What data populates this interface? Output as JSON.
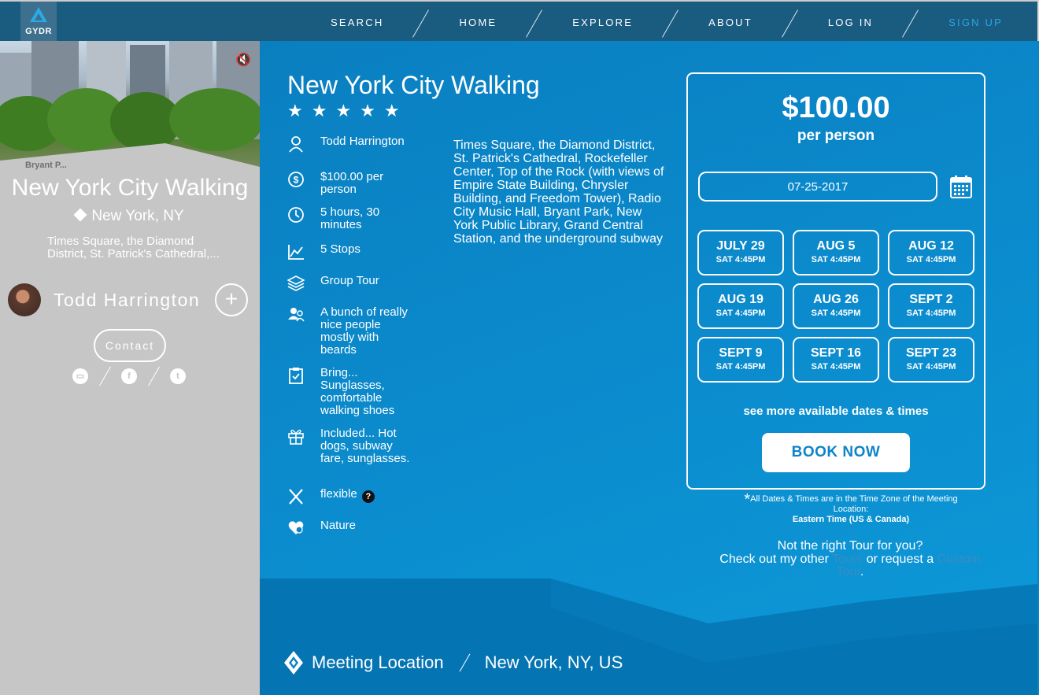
{
  "colors": {
    "header": "#1a5b80",
    "accent": "#28a8e4",
    "main_bg": "#0a84c4",
    "sidebar_bg": "#c6c6c6"
  },
  "header": {
    "logo_text": "GYDR",
    "nav": [
      {
        "label": "SEARCH"
      },
      {
        "label": "HOME"
      },
      {
        "label": "EXPLORE"
      },
      {
        "label": "ABOUT"
      },
      {
        "label": "LOG IN"
      },
      {
        "label": "SIGN UP"
      }
    ]
  },
  "sidebar": {
    "hero_caption": "Bryant P...",
    "title": "New York City Walking",
    "location": "New York, NY",
    "description": "Times Square, the Diamond District, St. Patrick's Cathedral,...",
    "guide_name": "Todd Harrington",
    "follow_symbol": "+",
    "contact_label": "Contact",
    "social_icons": [
      "monitor-icon",
      "facebook-icon",
      "twitter-icon"
    ]
  },
  "tour": {
    "title": "New York City Walking",
    "rating_stars": 5,
    "features": [
      {
        "icon": "user-icon",
        "label": "Todd Harrington"
      },
      {
        "icon": "dollar-icon",
        "label": "$100.00 per person"
      },
      {
        "icon": "clock-icon",
        "label": "5 hours, 30 minutes"
      },
      {
        "icon": "chart-icon",
        "label": "5 Stops"
      },
      {
        "icon": "layers-icon",
        "label": "Group Tour"
      },
      {
        "icon": "group-icon",
        "label": "A bunch of really nice people mostly with beards"
      },
      {
        "icon": "clipboard-icon",
        "label": "Bring... Sunglasses, comfortable walking shoes"
      },
      {
        "icon": "gift-icon",
        "label": "Included... Hot dogs, subway fare, sunglasses."
      },
      {
        "icon": "x-icon",
        "label": "flexible"
      },
      {
        "icon": "heart-icon",
        "label": "Nature"
      }
    ],
    "help_symbol": "?",
    "description": "Times Square, the Diamond District, St. Patrick's Cathedral, Rockefeller Center, Top of the Rock (with views of Empire State Building, Chrysler Building, and Freedom Tower), Radio City Music Hall, Bryant Park, New York Public Library, Grand Central Station, and the underground subway"
  },
  "booking": {
    "price": "$100.00",
    "per_person": "per person",
    "date_value": "07-25-2017",
    "dates": [
      {
        "date": "JULY 29",
        "time": "SAT 4:45PM"
      },
      {
        "date": "AUG 5",
        "time": "SAT 4:45PM"
      },
      {
        "date": "AUG 12",
        "time": "SAT 4:45PM"
      },
      {
        "date": "AUG 19",
        "time": "SAT 4:45PM"
      },
      {
        "date": "AUG 26",
        "time": "SAT 4:45PM"
      },
      {
        "date": "SEPT 2",
        "time": "SAT 4:45PM"
      },
      {
        "date": "SEPT 9",
        "time": "SAT 4:45PM"
      },
      {
        "date": "SEPT 16",
        "time": "SAT 4:45PM"
      },
      {
        "date": "SEPT 23",
        "time": "SAT 4:45PM"
      }
    ],
    "more_dates": "see more available dates & times",
    "book_now": "BOOK NOW"
  },
  "timezone": {
    "asterisk": "*",
    "note": "All Dates & Times are in the Time Zone of the Meeting Location:",
    "zone": "Eastern Time (US & Canada)"
  },
  "other_tours": {
    "question": "Not the right Tour for you?",
    "line_prefix": "Check out my other ",
    "tours_link": "Tours",
    "middle": " or request a ",
    "custom_link": "Custom Tour",
    "suffix": "."
  },
  "meeting": {
    "label": "Meeting Location",
    "value": "New York, NY, US"
  }
}
